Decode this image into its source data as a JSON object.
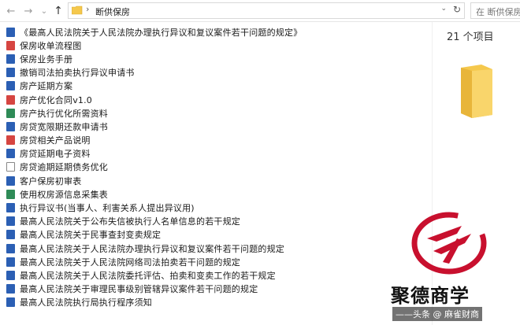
{
  "address_bar": {
    "path": "断供保房",
    "separator": "›",
    "search_placeholder": "在 断供保房"
  },
  "nav": {
    "back": "←",
    "forward": "→",
    "dropdown": "⌄",
    "up": "↑",
    "refresh": "↻"
  },
  "files": [
    {
      "name": "《最高人民法院关于人民法院办理执行异议和复议案件若干问题的规定》",
      "type": "word"
    },
    {
      "name": "保房收单流程图",
      "type": "pdf"
    },
    {
      "name": "保房业务手册",
      "type": "word"
    },
    {
      "name": "撤销司法拍卖执行异议申请书",
      "type": "word"
    },
    {
      "name": "房产延期方案",
      "type": "word"
    },
    {
      "name": "房产优化合同v1.0",
      "type": "pdf"
    },
    {
      "name": "房产执行优化所需资料",
      "type": "excel"
    },
    {
      "name": "房贷宽限期还款申请书",
      "type": "word"
    },
    {
      "name": "房贷相关产品说明",
      "type": "pdf"
    },
    {
      "name": "房贷延期电子资料",
      "type": "word"
    },
    {
      "name": "房贷逾期延期债务优化",
      "type": "video"
    },
    {
      "name": "客户保房初审表",
      "type": "word"
    },
    {
      "name": "使用权房源信息采集表",
      "type": "excel"
    },
    {
      "name": "执行异议书(当事人、利害关系人提出异议用)",
      "type": "word"
    },
    {
      "name": "最高人民法院关于公布失信被执行人名单信息的若干规定",
      "type": "word"
    },
    {
      "name": "最高人民法院关于民事查封变卖规定",
      "type": "word"
    },
    {
      "name": "最高人民法院关于人民法院办理执行异议和复议案件若干问题的规定",
      "type": "word"
    },
    {
      "name": "最高人民法院关于人民法院网络司法拍卖若干问题的规定",
      "type": "word"
    },
    {
      "name": "最高人民法院关于人民法院委托评估、拍卖和变卖工作的若干规定",
      "type": "word"
    },
    {
      "name": "最高人民法院关于审理民事级别管辖异议案件若干问题的规定",
      "type": "word"
    },
    {
      "name": "最高人民法院执行局执行程序须知",
      "type": "word"
    }
  ],
  "details_pane": {
    "item_count": "21 个项目"
  },
  "watermark": {
    "title": "聚德商学",
    "subtitle": "——头条 @ 麻雀财商"
  },
  "colors": {
    "word": "#2b5fb4",
    "pdf": "#d64541",
    "excel": "#2e8b57",
    "folder": "#f5c84c",
    "logo_red": "#c8102e"
  }
}
